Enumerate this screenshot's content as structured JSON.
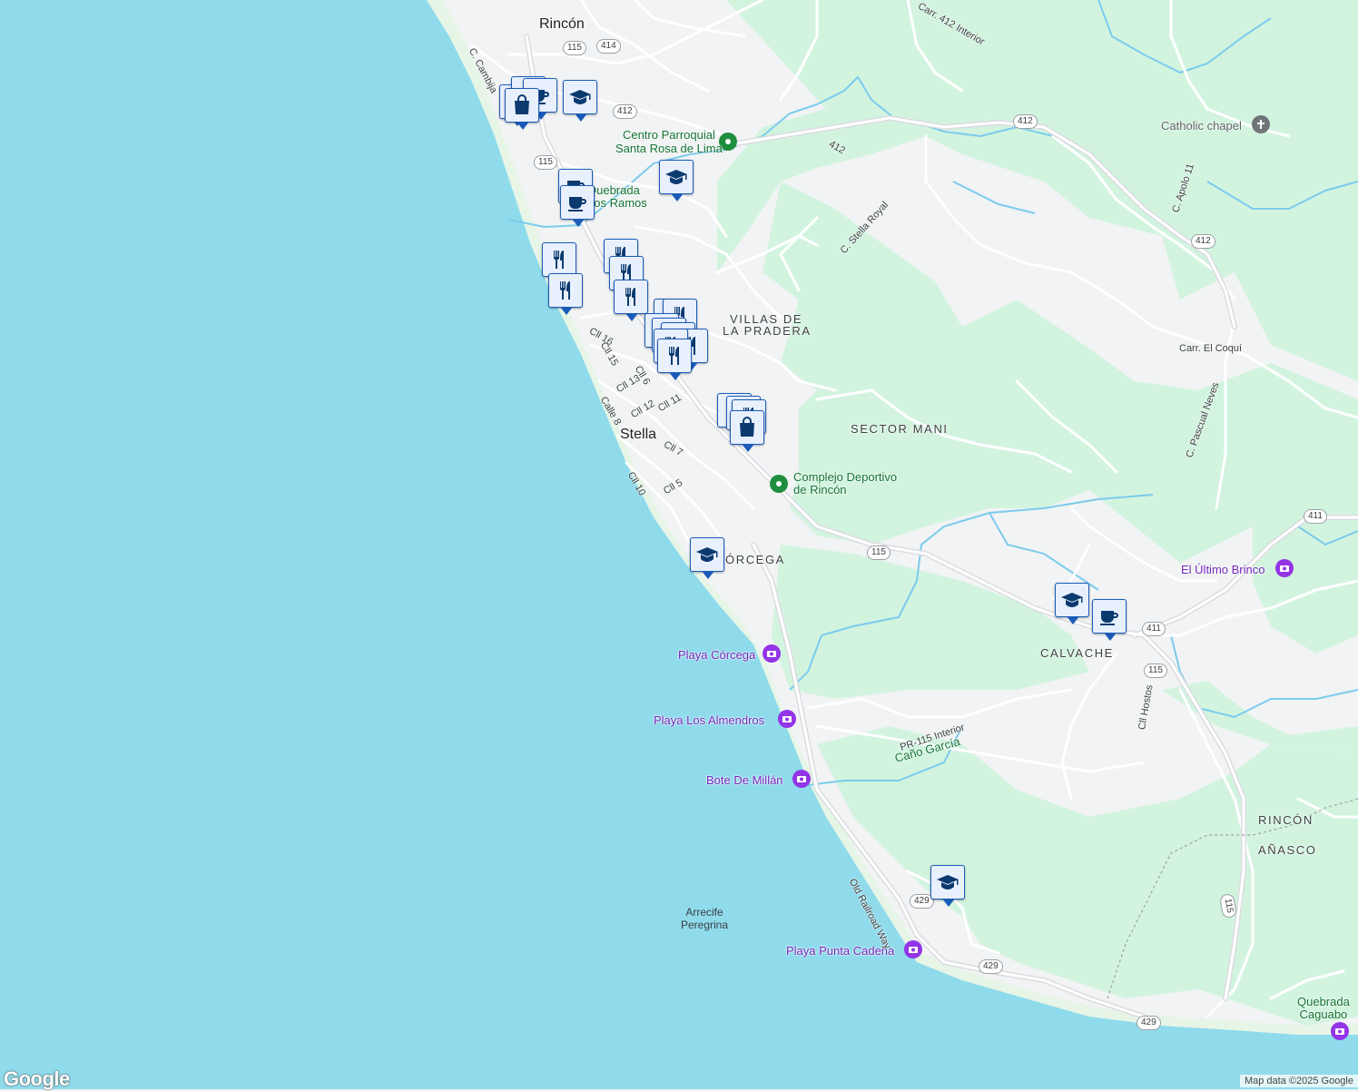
{
  "map": {
    "colors": {
      "water": "#8fdbec",
      "land": "#f1f3f4",
      "park": "#d2f4df",
      "beach": "#e6f5e6",
      "road": "#ffffff",
      "highway": "#dadce0",
      "stream": "#7ccbed"
    },
    "towns": {
      "rincon": "Rincón",
      "stella": "Stella",
      "calvache": "CALVACHE",
      "corcega": "CÓRCEGA",
      "villas_1": "VILLAS DE",
      "villas_2": "LA PRADERA",
      "sector_mani": "SECTOR MANI",
      "rincon_muni": "RINCÓN",
      "anasco_muni": "AÑASCO"
    },
    "pois": {
      "centro_1": "Centro Parroquial",
      "centro_2": "Santa Rosa de Lima",
      "complejo_1": "Complejo Deportivo",
      "complejo_2": "de Rincón",
      "catholic": "Catholic chapel",
      "ultimo": "El Último Brinco",
      "playa_corcega": "Playa Córcega",
      "playa_almendros": "Playa Los Almendros",
      "bote": "Bote De Millán",
      "punta_cadena": "Playa Punta Cadena",
      "quebrada_ramos_1": "Quebrada",
      "quebrada_ramos_2": "Los Ramos",
      "quebrada_caguabo_1": "Quebrada",
      "quebrada_caguabo_2": "Caguabo",
      "cano_garcia": "Caño García",
      "arrecife_1": "Arrecife",
      "arrecife_2": "Peregrina"
    },
    "streets": {
      "cambija": "C. Cambija",
      "s412int": "Carr. 412 Interior",
      "stella_royal": "C. Stella Royal",
      "apolo": "C. Apolo 11",
      "coqui": "Carr. El Coquí",
      "pascual": "C. Pascual Neves",
      "cll16": "Cll 16",
      "cll15": "Cll 15",
      "cll13": "Cll 13",
      "cll6": "Cll 6",
      "cll12": "Cll 12",
      "cll11": "Cll 11",
      "calle8": "Calle 8",
      "cll7": "Cll 7",
      "cll10": "Cll 10",
      "cll5": "Cll 5",
      "pr115int": "PR-115 Interior",
      "cllhostos": "Cll Hostos",
      "railroad": "Old Railroad Way",
      "a412": "412"
    },
    "shields": [
      "115",
      "414",
      "412",
      "115",
      "412",
      "412",
      "115",
      "411",
      "411",
      "115",
      "429",
      "429",
      "429",
      "115"
    ],
    "pins": {
      "restaurant": "restaurant-icon",
      "cafe": "cafe-icon",
      "school": "school-icon",
      "shopping": "shopping-bag-icon"
    },
    "logo": "Google",
    "attribution": "Map data ©2025 Google"
  }
}
